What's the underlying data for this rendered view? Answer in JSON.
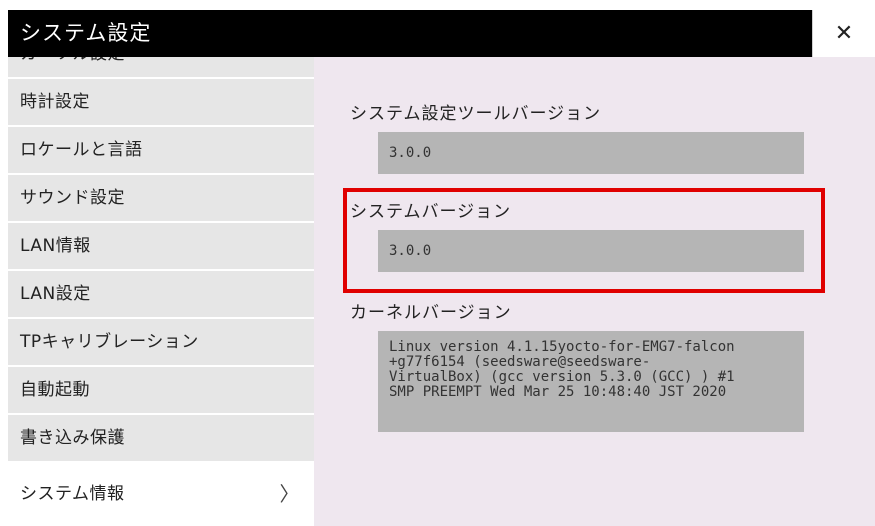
{
  "window": {
    "title": "システム設定",
    "close_symbol": "✕"
  },
  "sidebar": {
    "items": [
      {
        "label": "カーソル設定"
      },
      {
        "label": "時計設定"
      },
      {
        "label": "ロケールと言語"
      },
      {
        "label": "サウンド設定"
      },
      {
        "label": "LAN情報"
      },
      {
        "label": "LAN設定"
      },
      {
        "label": "TPキャリブレーション"
      },
      {
        "label": "自動起動"
      },
      {
        "label": "書き込み保護"
      },
      {
        "label": "システム情報",
        "active": true,
        "chevron": "〉"
      }
    ]
  },
  "info": {
    "tool_version_label": "システム設定ツールバージョン",
    "tool_version_value": "3.0.0",
    "system_version_label": "システムバージョン",
    "system_version_value": "3.0.0",
    "kernel_version_label": "カーネルバージョン",
    "kernel_version_value": "Linux version 4.1.15yocto-for-EMG7-falcon\n+g77f6154 (seedsware@seedsware-\nVirtualBox) (gcc version 5.3.0 (GCC) ) #1\nSMP PREEMPT Wed Mar 25 10:48:40 JST 2020"
  },
  "colors": {
    "titlebar": "#000000",
    "sidebar": "#e6e6e6",
    "content_bg": "#efe7ef",
    "value_box": "#b5b5b5",
    "highlight": "#e00000"
  }
}
